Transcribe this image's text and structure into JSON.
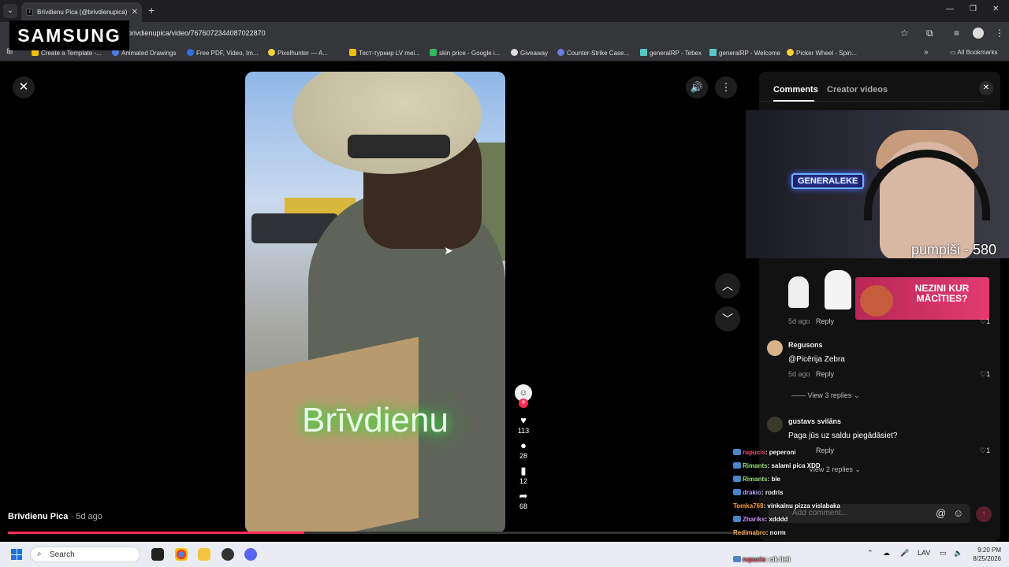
{
  "browser": {
    "tab_title": "Brīvdienu Pica (@brivdienupica)",
    "tab_icon": "tiktok-icon",
    "url": "brivdienupica/video/7676072344087022870",
    "bookmarks": [
      "Create a Template -...",
      "Animated Drawings",
      "Free PDF, Video, Im...",
      "Pixelhunter — A...",
      "Тест-турнир LV mei...",
      "skin price - Google i...",
      "Giveaway",
      "Counter-Strike Case...",
      "generalRP - Tebex",
      "generalRP - Welcome",
      "Picker Wheel - Spin..."
    ],
    "bookmarks_folder": "All Bookmarks"
  },
  "overlay_logo": "SAMSUNG",
  "video": {
    "overlay_text": "Brīvdienu",
    "author": "Brīvdienu Pica",
    "posted": "· 5d ago",
    "progress": 0.4,
    "likes": "113",
    "comments": "28",
    "saves": "12",
    "shares": "68"
  },
  "panel": {
    "tab_comments": "Comments",
    "tab_creator": "Creator videos",
    "add_comment_placeholder": "Add comment...",
    "ad_text": "NEZINI KUR MĀCĪTIES?"
  },
  "stream": {
    "neon_sign": "GENERALEKE",
    "counter": "pumpiši - 580"
  },
  "comments": [
    {
      "name": "",
      "text": "",
      "meta": "5d ago",
      "reply": "Reply",
      "likes": "1"
    },
    {
      "name": "Regusons",
      "text": "@Picērija Zebra",
      "meta": "5d ago",
      "reply": "Reply",
      "likes": "1",
      "view_replies": "View 3 replies"
    },
    {
      "name": "gustavs svilāns",
      "text": "Paga jūs uz saldu piegādāsiet?",
      "meta": "",
      "reply": "Reply",
      "likes": "1",
      "view_replies": "View 2 replies"
    }
  ],
  "chat": [
    {
      "user": "rupucis",
      "msg": ": peperoni",
      "color": "#ff4f6d"
    },
    {
      "user": "Rimants",
      "msg": ": salami pica XDD",
      "color": "#9be27a"
    },
    {
      "user": "Rimants",
      "msg": ": ble",
      "color": "#9be27a"
    },
    {
      "user": "drakio",
      "msg": ": rodris",
      "color": "#b9a3ff"
    },
    {
      "user": "Tomka768",
      "msg": ": vinkalnu pizza vislabaka",
      "color": "#ff9f3b"
    },
    {
      "user": "Zhariks",
      "msg": ": xdddd",
      "color": "#d08cff"
    },
    {
      "user": "Redimabro",
      "msg": ": norm",
      "color": "#ffb347"
    },
    {
      "user": "rupucis",
      "msg": ": cik lieli",
      "color": "#ff4f6d"
    }
  ],
  "taskbar": {
    "search_label": "Search",
    "language": "LAV",
    "time": "9:20 PM",
    "date": "8/25/2026"
  },
  "colors": {
    "accent": "#fe2c55",
    "panel_bg": "#121212"
  }
}
